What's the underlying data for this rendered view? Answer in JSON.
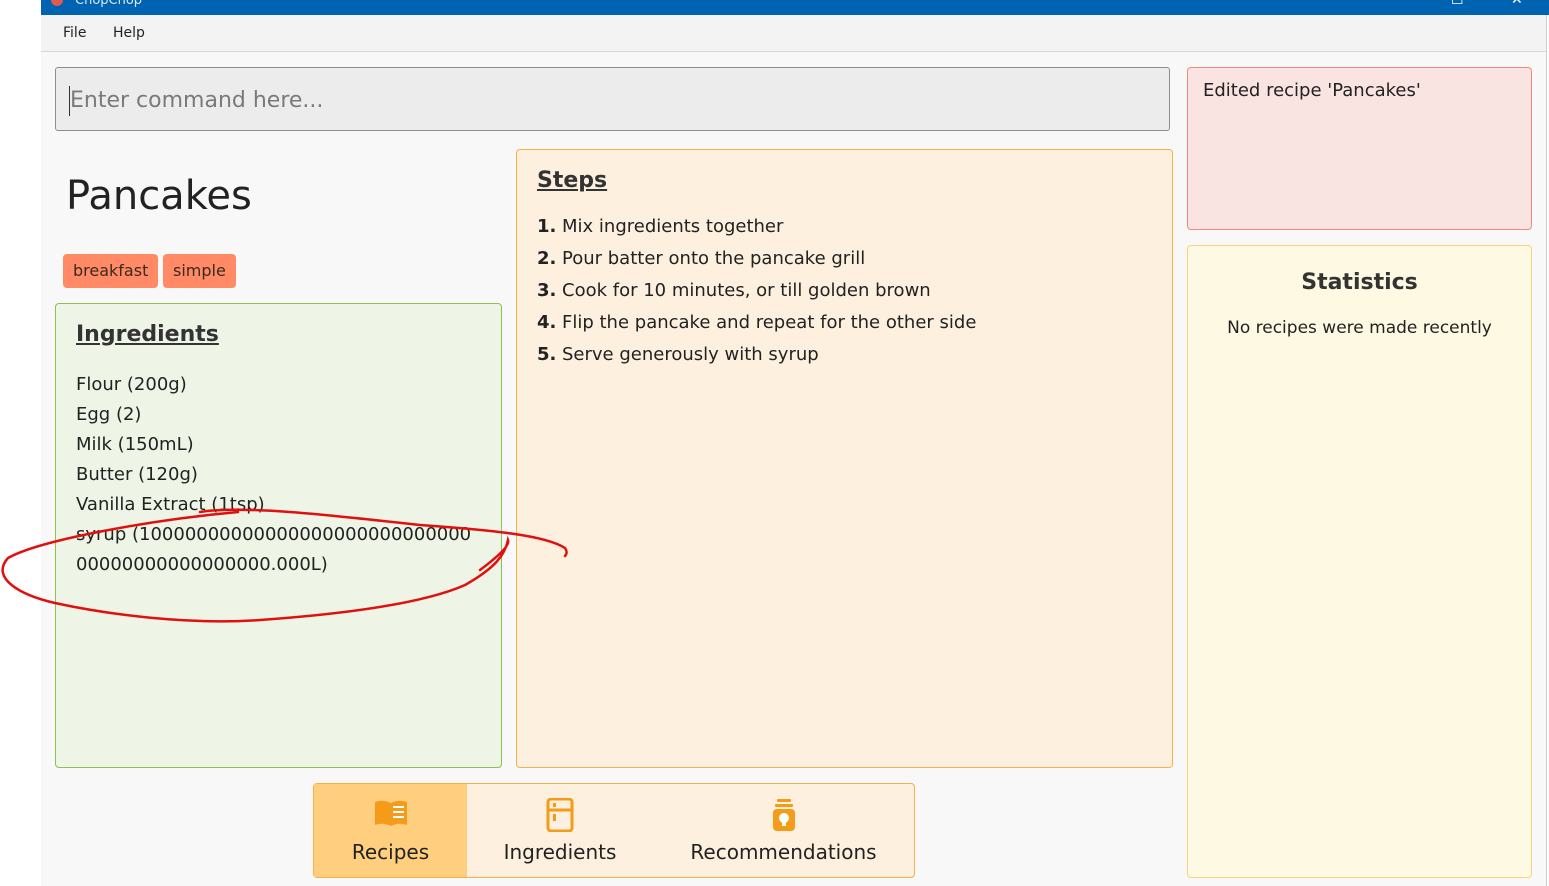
{
  "window": {
    "title": "ChopChop"
  },
  "menu": {
    "file": "File",
    "help": "Help"
  },
  "command": {
    "placeholder": "Enter command here..."
  },
  "recipe": {
    "name": "Pancakes",
    "tags": [
      "breakfast",
      "simple"
    ],
    "ingredients_heading": "Ingredients",
    "ingredients": [
      "Flour (200g)",
      "Egg (2)",
      "Milk (150mL)",
      "Butter (120g)",
      "Vanilla Extract (1tsp)",
      "syrup (1000000000000000000000000000000000000000000000.000L)"
    ],
    "steps_heading": "Steps",
    "steps": [
      {
        "num": "1.",
        "text": "Mix ingredients together"
      },
      {
        "num": "2.",
        "text": "Pour batter onto the pancake grill"
      },
      {
        "num": "3.",
        "text": "Cook for 10 minutes, or till golden brown"
      },
      {
        "num": "4.",
        "text": "Flip the pancake and repeat for the other side"
      },
      {
        "num": "5.",
        "text": "Serve generously with syrup"
      }
    ]
  },
  "feedback": {
    "message": "Edited recipe 'Pancakes'"
  },
  "statistics": {
    "title": "Statistics",
    "message": "No recipes were made recently"
  },
  "tabs": [
    {
      "label": "Recipes",
      "icon": "book-icon",
      "active": true
    },
    {
      "label": "Ingredients",
      "icon": "fridge-icon",
      "active": false
    },
    {
      "label": "Recommendations",
      "icon": "lightbulb-jar-icon",
      "active": false
    }
  ],
  "colors": {
    "accent": "#f4b14a",
    "tag": "#ff8a65",
    "ingredients_border": "#8bc34a",
    "feedback_border": "#f08a7e",
    "annotation": "#e01010"
  }
}
